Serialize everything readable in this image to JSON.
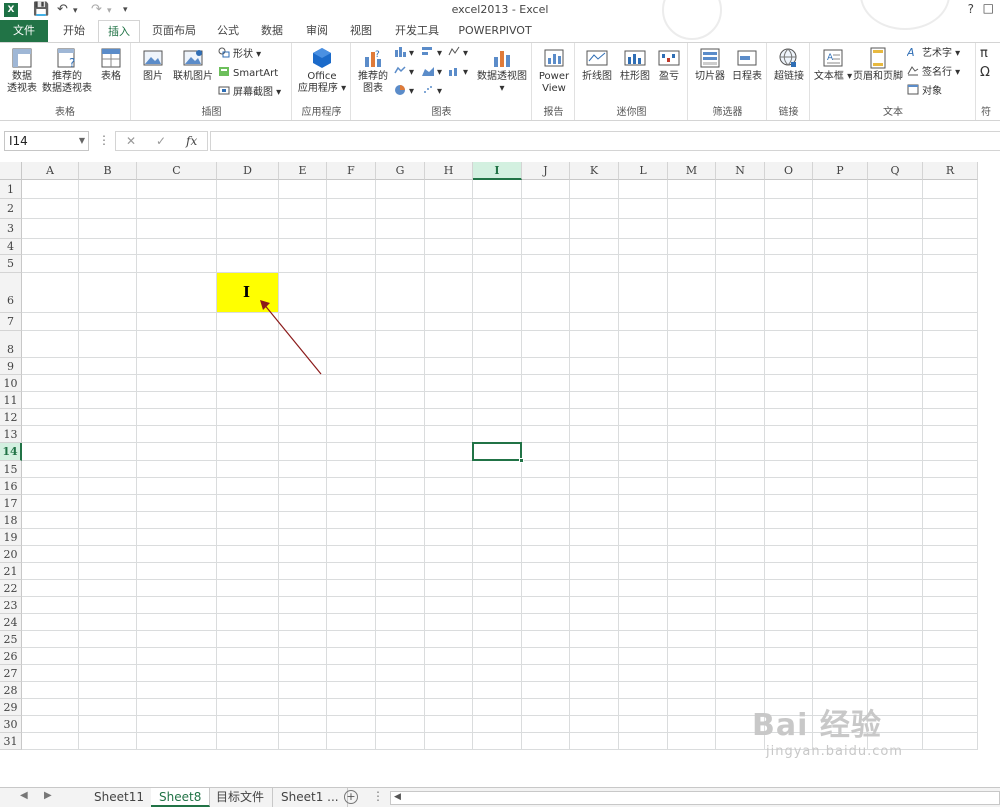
{
  "title_bar": {
    "title": "excel2013 - Excel",
    "help": "?",
    "logo": "X"
  },
  "tabs": [
    "文件",
    "开始",
    "插入",
    "页面布局",
    "公式",
    "数据",
    "审阅",
    "视图",
    "开发工具",
    "POWERPIVOT"
  ],
  "active_tab": "插入",
  "ribbon": {
    "groups": {
      "tables": "表格",
      "illustrations": "插图",
      "apps": "应用程序",
      "charts": "图表",
      "reports": "报告",
      "sparklines": "迷你图",
      "filters": "筛选器",
      "links": "链接",
      "text": "文本",
      "symbols": "符"
    },
    "buttons": {
      "pivot_table": "数据\n透视表",
      "pivot_table_l1": "数据",
      "pivot_table_l2": "透视表",
      "recommended_pivot_l1": "推荐的",
      "recommended_pivot_l2": "数据透视表",
      "table": "表格",
      "pictures": "图片",
      "online_pictures": "联机图片",
      "shapes": "形状",
      "smartart": "SmartArt",
      "screenshot": "屏幕截图",
      "office_apps_l1": "Office",
      "office_apps_l2": "应用程序",
      "recommended_charts_l1": "推荐的",
      "recommended_charts_l2": "图表",
      "pivot_chart": "数据透视图",
      "power_view_l1": "Power",
      "power_view_l2": "View",
      "line": "折线图",
      "column": "柱形图",
      "win_loss": "盈亏",
      "slicer": "切片器",
      "timeline": "日程表",
      "hyperlink": "超链接",
      "textbox": "文本框",
      "header_footer": "页眉和页脚",
      "wordart": "艺术字",
      "signature": "签名行",
      "object": "对象"
    }
  },
  "formula_bar": {
    "name_box": "I14",
    "fx": "fx",
    "value": ""
  },
  "columns": [
    "A",
    "B",
    "C",
    "D",
    "E",
    "F",
    "G",
    "H",
    "I",
    "J",
    "K",
    "L",
    "M",
    "N",
    "O",
    "P",
    "Q",
    "R"
  ],
  "rows": [
    "1",
    "2",
    "3",
    "4",
    "5",
    "6",
    "7",
    "8",
    "9",
    "10",
    "11",
    "12",
    "13",
    "14",
    "15",
    "16",
    "17",
    "18",
    "19",
    "20",
    "21",
    "22",
    "23",
    "24",
    "25",
    "26",
    "27",
    "28",
    "29",
    "30",
    "31"
  ],
  "selected_cell": "I14",
  "highlighted_cell": {
    "ref": "D6",
    "color": "#ffff00"
  },
  "sheets": [
    "Sheet11",
    "Sheet8",
    "目标文件",
    "Sheet1 ..."
  ],
  "active_sheet": "Sheet8",
  "colors": {
    "accent": "#217346",
    "arrow": "#8b1a1a"
  },
  "watermark": {
    "brand": "Bai 经验",
    "url": "jingyan.baidu.com"
  }
}
